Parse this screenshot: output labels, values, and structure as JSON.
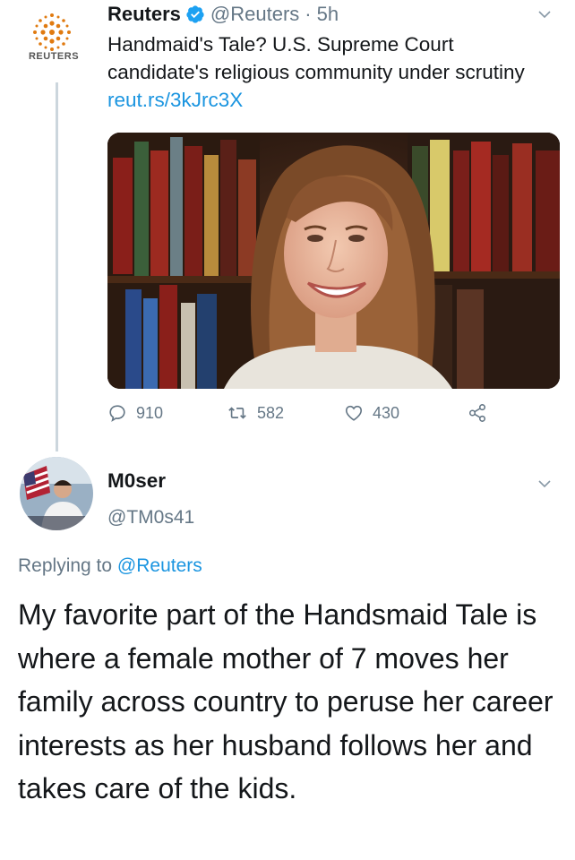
{
  "tweet1": {
    "logo_text": "REUTERS",
    "name": "Reuters",
    "handle": "@Reuters",
    "separator": "·",
    "time": "5h",
    "text": "Handmaid's Tale? U.S. Supreme Court candidate's religious community under scrutiny ",
    "link": "reut.rs/3kJrc3X",
    "actions": {
      "replies": "910",
      "retweets": "582",
      "likes": "430"
    }
  },
  "tweet2": {
    "name": "M0ser",
    "handle": "@TM0s41",
    "replying_prefix": "Replying to ",
    "replying_to": "@Reuters",
    "text": "My favorite part of the Handsmaid Tale is where a female mother of 7 moves her family across country to peruse her career interests as her husband follows her and takes care of the kids."
  },
  "icons": {
    "verified": "verified-badge-icon",
    "chevron": "chevron-down-icon",
    "reply": "reply-icon",
    "retweet": "retweet-icon",
    "like": "heart-icon",
    "share": "share-icon"
  },
  "colors": {
    "link": "#1b95e0",
    "muted": "#657786",
    "text": "#14171a",
    "verified": "#1da1f2",
    "thread_line": "#ccd6dd"
  }
}
